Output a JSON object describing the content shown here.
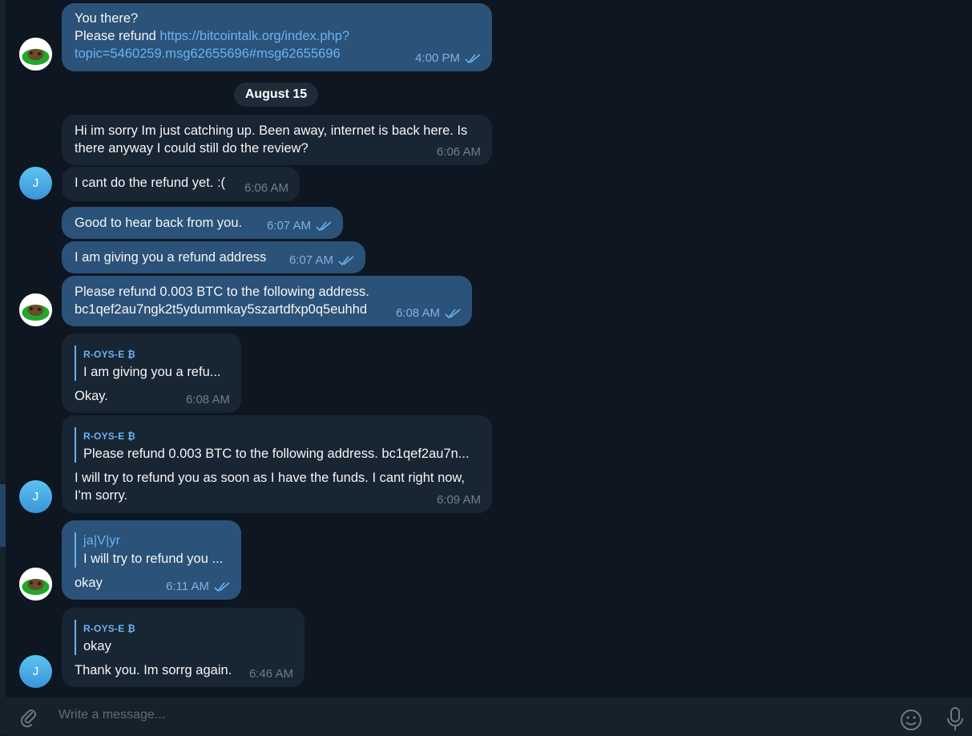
{
  "conversation": {
    "messages": [
      {
        "id": "m1",
        "direction": "out",
        "lines": [
          "You there?"
        ],
        "prefix": "Please refund ",
        "link": "https://bitcointalk.org/index.php?",
        "link2": "topic=5460259.msg62655696#msg62655696",
        "time": "4:00 PM"
      },
      {
        "id": "m2",
        "direction": "in",
        "text": "Hi im sorry Im just catching up. Been away, internet is back here. Is there anyway I could still do the review?",
        "time": "6:06 AM"
      },
      {
        "id": "m3",
        "direction": "in",
        "text": "I cant do the refund yet. :(",
        "time": "6:06 AM"
      },
      {
        "id": "m4",
        "direction": "out",
        "text": "Good to hear back from you.",
        "time": "6:07 AM"
      },
      {
        "id": "m5",
        "direction": "out",
        "text": "I am giving you a refund address",
        "time": "6:07 AM"
      },
      {
        "id": "m6",
        "direction": "out",
        "line1": "Please refund 0.003 BTC to the following address.",
        "line2": "bc1qef2au7ngk2t5ydummkay5szartdfxp0q5euhhd",
        "time": "6:08 AM"
      },
      {
        "id": "m7",
        "direction": "in",
        "reply_name": "R-OYS-E ₿",
        "reply_text": "I am giving you a refu...",
        "text": "Okay.",
        "time": "6:08 AM"
      },
      {
        "id": "m8",
        "direction": "in",
        "reply_name": "R-OYS-E ₿",
        "reply_text": "Please refund 0.003 BTC to the following address. bc1qef2au7n...",
        "line1": "I will try to refund you as soon as I have the funds. I cant right now,",
        "line2": "I'm sorry.",
        "time": "6:09 AM"
      },
      {
        "id": "m9",
        "direction": "out",
        "reply_name": "ja|V|yr",
        "reply_text": "I will try to refund you ...",
        "text": "okay",
        "time": "6:11 AM"
      },
      {
        "id": "m10",
        "direction": "in",
        "reply_name": "R-OYS-E ₿",
        "reply_text": "okay",
        "text": "Thank you. Im sorrg again.",
        "time": "6:46 AM"
      }
    ],
    "date_separator": "August 15",
    "avatar_initial": "J"
  },
  "composer": {
    "placeholder": "Write a message...",
    "icons": [
      "paperclip-icon",
      "emoji-icon",
      "microphone-icon"
    ]
  },
  "colors": {
    "background": "#0e1621",
    "outgoing_bubble": "#2b5278",
    "incoming_bubble": "#182533",
    "accent": "#6ab3f3"
  }
}
